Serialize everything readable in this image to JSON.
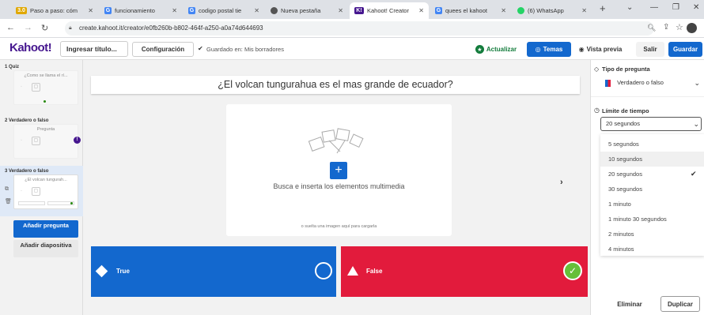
{
  "browser": {
    "tabs": [
      {
        "label": "Paso a paso: cóm",
        "fav_text": "3.0",
        "fav_color": "#e0a800"
      },
      {
        "label": "funcionamiento",
        "fav_text": "G",
        "fav_color": "#4285f4"
      },
      {
        "label": "codigo postal tie",
        "fav_text": "G",
        "fav_color": "#4285f4"
      },
      {
        "label": "Nueva pestaña",
        "fav_text": "●",
        "fav_color": "#555555"
      },
      {
        "label": "Kahoot! Creator",
        "fav_text": "K!",
        "fav_color": "#46178f"
      },
      {
        "label": "quees el kahoot",
        "fav_text": "G",
        "fav_color": "#4285f4"
      },
      {
        "label": "(6) WhatsApp",
        "fav_text": "●",
        "fav_color": "#25d366"
      }
    ],
    "new_tab": "+",
    "url": "create.kahoot.it/creator/e0fb260b-b802-464f-a250-a0a74d644693"
  },
  "header": {
    "logo": "Kahoot!",
    "title_placeholder": "Ingresar título...",
    "config_label": "Configuración",
    "saved_status": "Guardado en: Mis borradores",
    "update_label": "Actualizar",
    "themes_label": "Temas",
    "preview_label": "Vista previa",
    "exit_label": "Salir",
    "save_label": "Guardar"
  },
  "sidebar": {
    "slides": [
      {
        "label": "1 Quiz",
        "preview": "¿Como se llama el rí..."
      },
      {
        "label": "2 Verdadero o falso",
        "preview": "Pregunta"
      },
      {
        "label": "3 Verdadero o falso",
        "preview": "¿El volcan tungurah..."
      }
    ],
    "add_question": "Añadir pregunta",
    "add_slide": "Añadir diapositiva"
  },
  "question": {
    "title": "¿El volcan tungurahua es el mas grande de ecuador?",
    "media_hint": "Busca e inserta los elementos multimedia",
    "drop_hint": "o suelta una imagen aquí para cargarla",
    "answers": [
      {
        "label": "True",
        "color": "#1368ce",
        "correct": false
      },
      {
        "label": "False",
        "color": "#e21b3c",
        "correct": true
      }
    ]
  },
  "panel": {
    "question_type_label": "Tipo de pregunta",
    "question_type_value": "Verdadero o falso",
    "time_limit_label": "Límite de tiempo",
    "time_limit_value": "20 segundos",
    "time_options": [
      "5 segundos",
      "10 segundos",
      "20 segundos",
      "30 segundos",
      "1 minuto",
      "1 minuto 30 segundos",
      "2 minutos",
      "4 minutos"
    ],
    "delete_label": "Eliminar",
    "duplicate_label": "Duplicar"
  }
}
